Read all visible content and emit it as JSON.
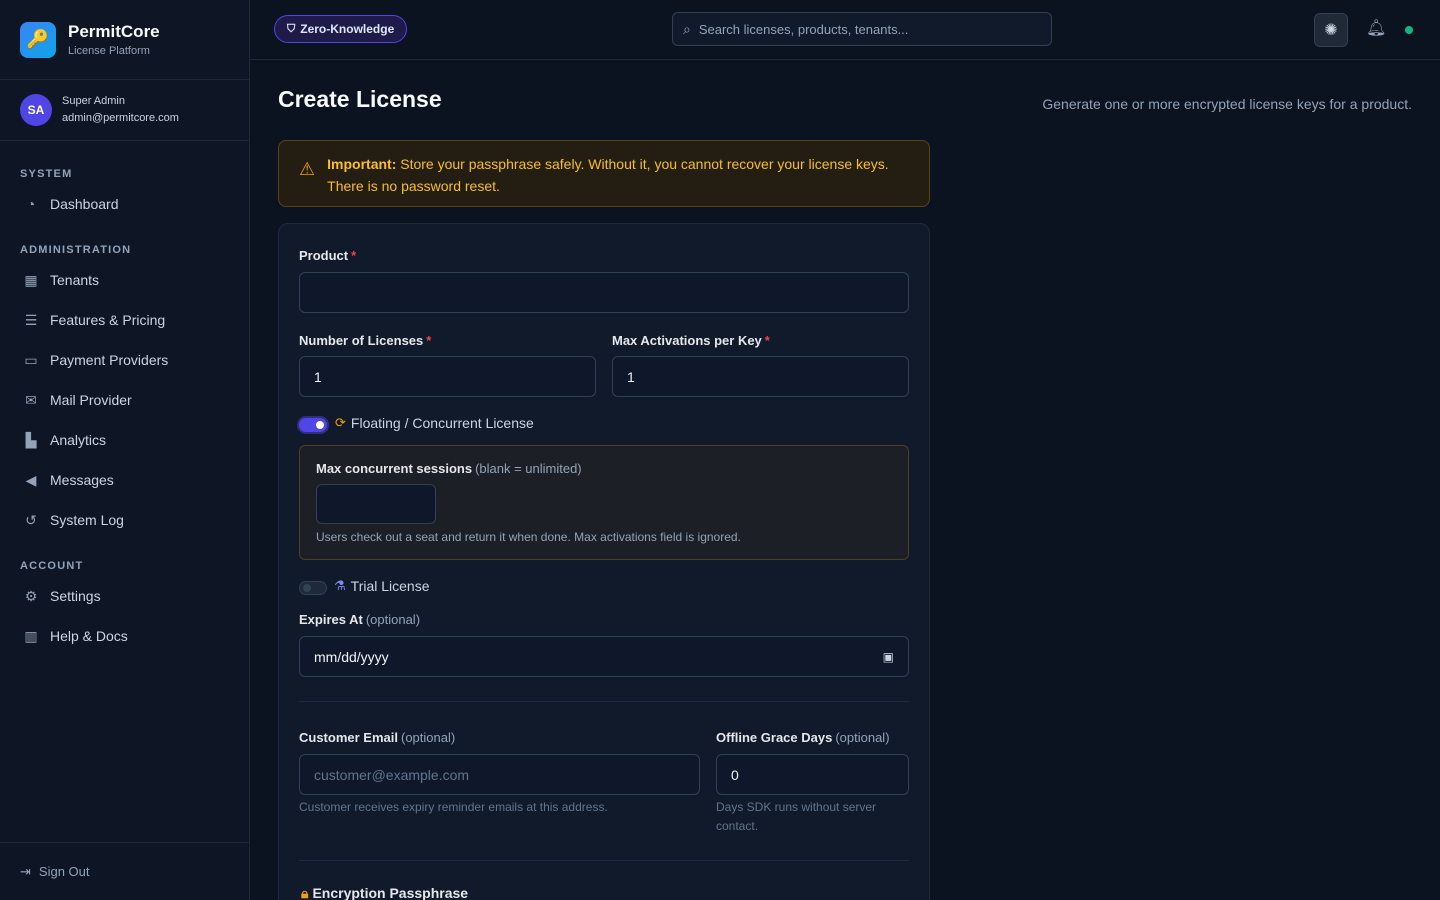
{
  "brand": {
    "name": "PermitCore",
    "subtitle": "License Platform"
  },
  "user": {
    "initials": "SA",
    "role": "Super Admin",
    "email": "admin@permitcore.com"
  },
  "sidebar": {
    "sections": [
      {
        "title": "SYSTEM",
        "items": [
          {
            "label": "Dashboard",
            "icon": "dashboard-icon"
          }
        ]
      },
      {
        "title": "ADMINISTRATION",
        "items": [
          {
            "label": "Tenants",
            "icon": "building-icon"
          },
          {
            "label": "Features & Pricing",
            "icon": "sliders-icon"
          },
          {
            "label": "Payment Providers",
            "icon": "credit-card-icon"
          },
          {
            "label": "Mail Provider",
            "icon": "envelope-icon"
          },
          {
            "label": "Analytics",
            "icon": "chart-icon"
          },
          {
            "label": "Messages",
            "icon": "megaphone-icon"
          },
          {
            "label": "System Log",
            "icon": "history-icon"
          }
        ]
      },
      {
        "title": "ACCOUNT",
        "items": [
          {
            "label": "Settings",
            "icon": "gear-icon"
          },
          {
            "label": "Help & Docs",
            "icon": "book-icon"
          }
        ]
      }
    ],
    "sign_out": "Sign Out"
  },
  "topbar": {
    "badge": "Zero-Knowledge",
    "search_placeholder": "Search licenses, products, tenants..."
  },
  "page": {
    "title": "Create License",
    "description": "Generate one or more encrypted license keys for a product."
  },
  "alert": {
    "strong": "Important:",
    "line1": "Store your passphrase safely. Without it, you cannot recover your license keys.",
    "line2": "There is no password reset."
  },
  "form": {
    "product_label": "Product",
    "product_value": "",
    "num_licenses_label": "Number of Licenses",
    "num_licenses_value": "1",
    "max_activations_label": "Max Activations per Key",
    "max_activations_value": "1",
    "floating_toggle": {
      "label": "Floating / Concurrent License",
      "on": true
    },
    "max_sessions_label": "Max concurrent sessions",
    "max_sessions_note": "(blank = unlimited)",
    "max_sessions_value": "",
    "max_sessions_hint": "Users check out a seat and return it when done. Max activations field is ignored.",
    "trial_toggle": {
      "label": "Trial License",
      "on": false
    },
    "expires_label": "Expires At",
    "expires_optional": "(optional)",
    "expires_value": "mm/dd/yyyy",
    "email_label": "Customer Email",
    "email_optional": "(optional)",
    "email_placeholder": "customer@example.com",
    "email_hint": "Customer receives expiry reminder emails at this address.",
    "grace_label": "Offline Grace Days",
    "grace_optional": "(optional)",
    "grace_value": "0",
    "grace_hint_line1": "Days SDK runs without server",
    "grace_hint_line2": "contact.",
    "passphrase_label": "Encryption Passphrase",
    "required_mark": "*"
  },
  "colors": {
    "accent": "#4f46e5",
    "warning": "#fbbf24",
    "success": "#10b981",
    "background": "#0b1220"
  }
}
